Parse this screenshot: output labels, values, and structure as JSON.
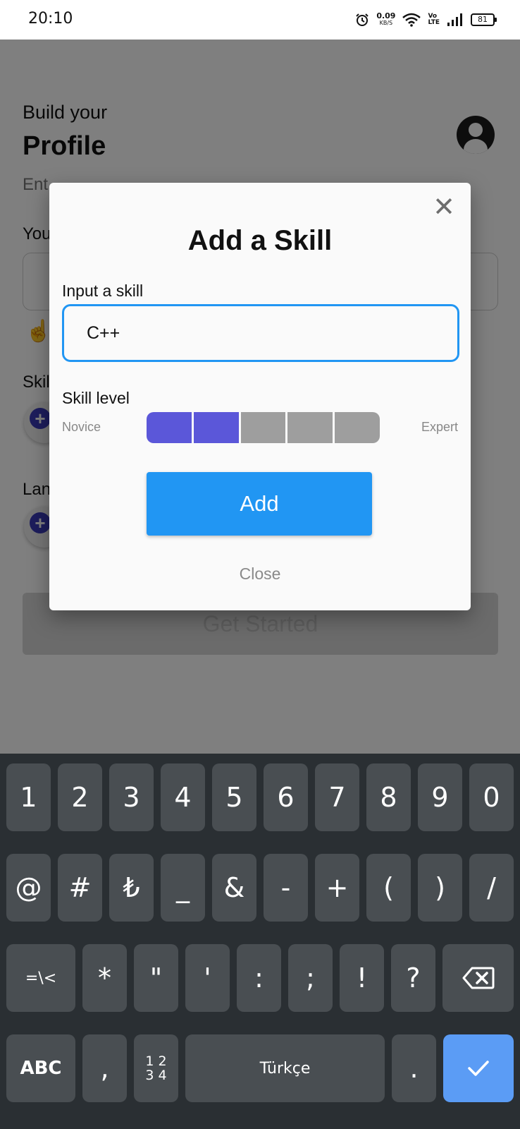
{
  "status_bar": {
    "time": "20:10",
    "net_speed": "0.09",
    "net_unit": "KB/S",
    "volte_top": "Vo",
    "volte_bottom": "LTE",
    "battery": "81"
  },
  "background": {
    "kicker": "Build your",
    "title": "Profile",
    "subtitle": "Ent",
    "your_label": "You",
    "skills_label": "Skil",
    "languages_label": "Lan",
    "get_started": "Get Started"
  },
  "dialog": {
    "title": "Add a Skill",
    "input_label": "Input a skill",
    "input_value": "C++",
    "level_label": "Skill level",
    "novice": "Novice",
    "expert": "Expert",
    "level": 2,
    "level_max": 5,
    "active_color": "#5b57d9",
    "inactive_color": "#9e9e9e",
    "add_button": "Add",
    "close_link": "Close"
  },
  "keyboard": {
    "row1": [
      "1",
      "2",
      "3",
      "4",
      "5",
      "6",
      "7",
      "8",
      "9",
      "0"
    ],
    "row2": [
      "@",
      "#",
      "₺",
      "_",
      "&",
      "-",
      "+",
      "(",
      ")",
      "/"
    ],
    "row3": [
      "=\\<",
      "*",
      "\"",
      "'",
      ":",
      ";",
      "!",
      "?"
    ],
    "abc": "ABC",
    "comma": ",",
    "numpad_top": "1 2",
    "numpad_bottom": "3 4",
    "space": "Türkçe",
    "period": "."
  }
}
